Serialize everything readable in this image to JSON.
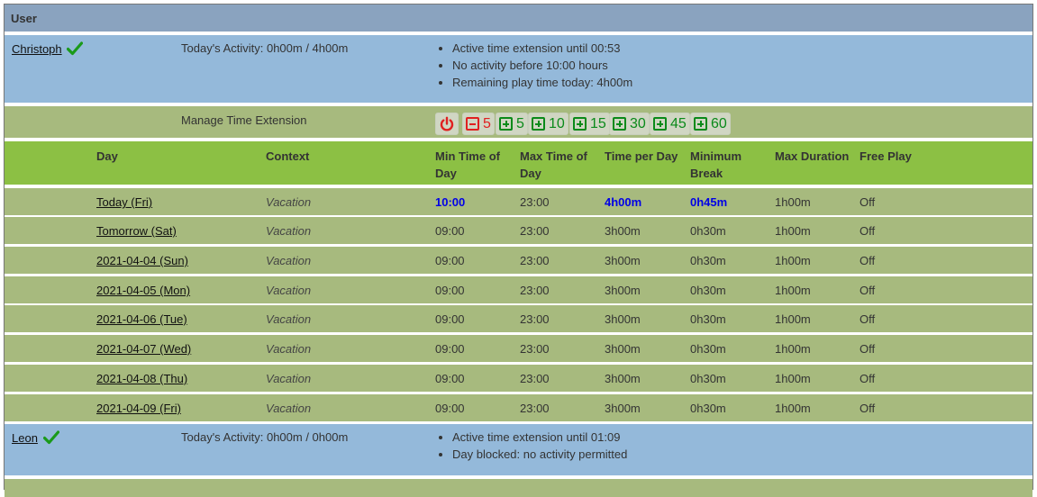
{
  "header": {
    "title": "User"
  },
  "users": [
    {
      "name": "Christoph",
      "activity": "Today's Activity: 0h00m / 4h00m",
      "notes": [
        "Active time extension until 00:53",
        "No activity before 10:00 hours",
        "Remaining play time today: 4h00m"
      ]
    },
    {
      "name": "Leon",
      "activity": "Today's Activity: 0h00m / 0h00m",
      "notes": [
        "Active time extension until 01:09",
        "Day blocked: no activity permitted"
      ]
    }
  ],
  "manage": {
    "label": "Manage Time Extension",
    "buttons": [
      {
        "icon": "power-icon",
        "label": "",
        "color": "#e02020"
      },
      {
        "icon": "minus-square-icon",
        "label": "5",
        "color": "#e02020"
      },
      {
        "icon": "plus-square-icon",
        "label": "5",
        "color": "#0a8a1a"
      },
      {
        "icon": "plus-square-icon",
        "label": "10",
        "color": "#0a8a1a"
      },
      {
        "icon": "plus-square-icon",
        "label": "15",
        "color": "#0a8a1a"
      },
      {
        "icon": "plus-square-icon",
        "label": "30",
        "color": "#0a8a1a"
      },
      {
        "icon": "plus-square-icon",
        "label": "45",
        "color": "#0a8a1a"
      },
      {
        "icon": "plus-square-icon",
        "label": "60",
        "color": "#0a8a1a"
      }
    ]
  },
  "table": {
    "columns": [
      "Day",
      "Context",
      "Min Time of Day",
      "Max Time of Day",
      "Time per Day",
      "Minimum Break",
      "Max Duration",
      "Free Play"
    ],
    "rows": [
      [
        "Today (Fri)",
        "Vacation",
        "10:00",
        "23:00",
        "4h00m",
        "0h45m",
        "1h00m",
        "Off"
      ],
      [
        "Tomorrow (Sat)",
        "Vacation",
        "09:00",
        "23:00",
        "3h00m",
        "0h30m",
        "1h00m",
        "Off"
      ],
      [
        "2021-04-04 (Sun)",
        "Vacation",
        "09:00",
        "23:00",
        "3h00m",
        "0h30m",
        "1h00m",
        "Off"
      ],
      [
        "2021-04-05 (Mon)",
        "Vacation",
        "09:00",
        "23:00",
        "3h00m",
        "0h30m",
        "1h00m",
        "Off"
      ],
      [
        "2021-04-06 (Tue)",
        "Vacation",
        "09:00",
        "23:00",
        "3h00m",
        "0h30m",
        "1h00m",
        "Off"
      ],
      [
        "2021-04-07 (Wed)",
        "Vacation",
        "09:00",
        "23:00",
        "3h00m",
        "0h30m",
        "1h00m",
        "Off"
      ],
      [
        "2021-04-08 (Thu)",
        "Vacation",
        "09:00",
        "23:00",
        "3h00m",
        "0h30m",
        "1h00m",
        "Off"
      ],
      [
        "2021-04-09 (Fri)",
        "Vacation",
        "09:00",
        "23:00",
        "3h00m",
        "0h30m",
        "1h00m",
        "Off"
      ]
    ]
  },
  "colors": {
    "header": "#8aa3bf",
    "user_row": "#94b9da",
    "table_header": "#8cc044",
    "day_row": "#a7ba7e",
    "highlight": "#0000e6",
    "check": "#1a9a1a"
  }
}
